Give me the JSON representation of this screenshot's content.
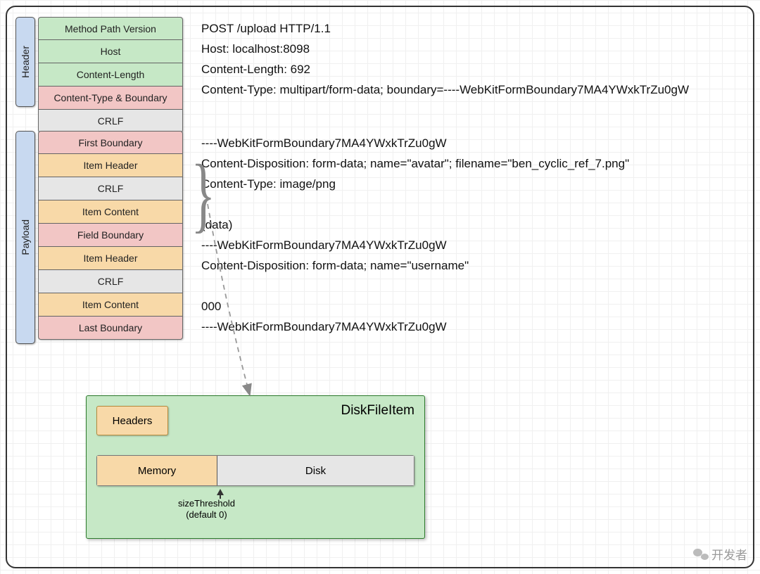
{
  "labels": {
    "header": "Header",
    "payload": "Payload"
  },
  "header_rows": [
    {
      "label": "Method Path Version",
      "color": "c-green"
    },
    {
      "label": "Host",
      "color": "c-green"
    },
    {
      "label": "Content-Length",
      "color": "c-green"
    },
    {
      "label": "Content-Type & Boundary",
      "color": "c-pink"
    }
  ],
  "between_row": {
    "label": "CRLF",
    "color": "c-gray"
  },
  "payload_rows": [
    {
      "label": "First Boundary",
      "color": "c-pink"
    },
    {
      "label": "Item Header",
      "color": "c-orange"
    },
    {
      "label": "CRLF",
      "color": "c-gray"
    },
    {
      "label": "Item Content",
      "color": "c-orange"
    },
    {
      "label": "Field Boundary",
      "color": "c-pink"
    },
    {
      "label": "Item Header",
      "color": "c-orange"
    },
    {
      "label": "CRLF",
      "color": "c-gray"
    },
    {
      "label": "Item Content",
      "color": "c-orange"
    },
    {
      "label": "Last Boundary",
      "color": "c-pink"
    }
  ],
  "http_text": {
    "line1": "POST /upload HTTP/1.1",
    "line2": "Host: localhost:8098",
    "line3": "Content-Length: 692",
    "line4": "Content-Type: multipart/form-data; boundary=----WebKitFormBoundary7MA4YWxkTrZu0gW",
    "line5": "----WebKitFormBoundary7MA4YWxkTrZu0gW",
    "line6": "Content-Disposition: form-data; name=\"avatar\"; filename=\"ben_cyclic_ref_7.png\"",
    "line7": "Content-Type: image/png",
    "line8": "(data)",
    "line9": "----WebKitFormBoundary7MA4YWxkTrZu0gW",
    "line10": "Content-Disposition: form-data; name=\"username\"",
    "line11": "000",
    "line12": "----WebKitFormBoundary7MA4YWxkTrZu0gW"
  },
  "dfi": {
    "title": "DiskFileItem",
    "headers": "Headers",
    "memory": "Memory",
    "disk": "Disk",
    "threshold": "sizeThreshold",
    "threshold_default": "(default 0)"
  },
  "watermark": "开发者"
}
